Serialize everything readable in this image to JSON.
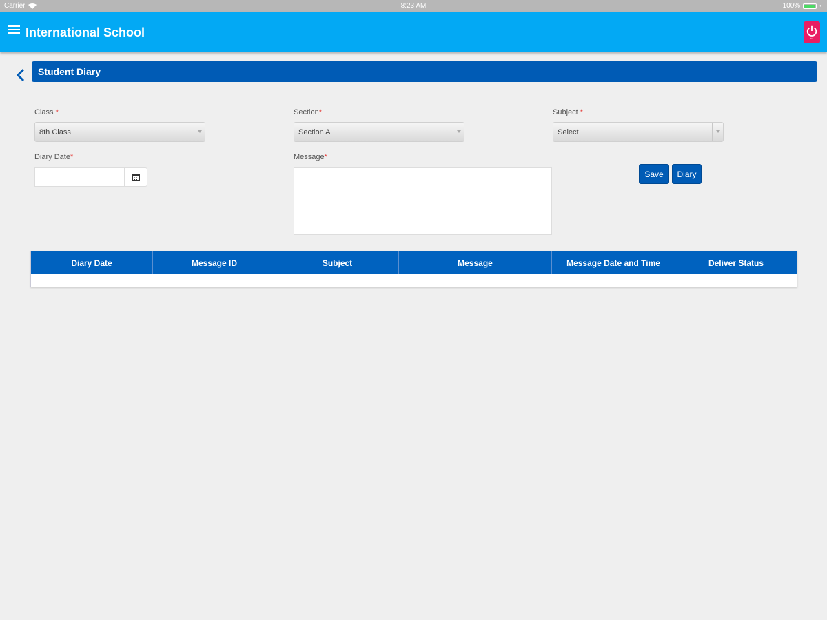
{
  "status_bar": {
    "carrier": "Carrier",
    "time": "8:23 AM",
    "battery": "100%"
  },
  "header": {
    "title": "International School",
    "menu_icon": "hamburger-icon",
    "power_icon": "power-icon"
  },
  "page": {
    "title": "Student Diary",
    "back_icon": "chevron-left-icon"
  },
  "form": {
    "class_label": "Class",
    "class_value": "8th Class",
    "section_label": "Section",
    "section_value": "Section A",
    "subject_label": "Subject",
    "subject_value": "Select",
    "diary_date_label": "Diary Date",
    "diary_date_value": "",
    "message_label": "Message",
    "message_value": "",
    "required_mark": "*"
  },
  "actions": {
    "save_label": "Save",
    "diary_label": "Diary"
  },
  "grid": {
    "columns": [
      "Diary Date",
      "Message ID",
      "Subject",
      "Message",
      "Message Date and Time",
      "Deliver Status"
    ],
    "rows": []
  },
  "colors": {
    "header_bg": "#03a9f4",
    "banner_bg": "#005bb5",
    "grid_header_bg": "#0062bf",
    "power_btn_bg": "#e91e63",
    "required": "#e53935"
  }
}
